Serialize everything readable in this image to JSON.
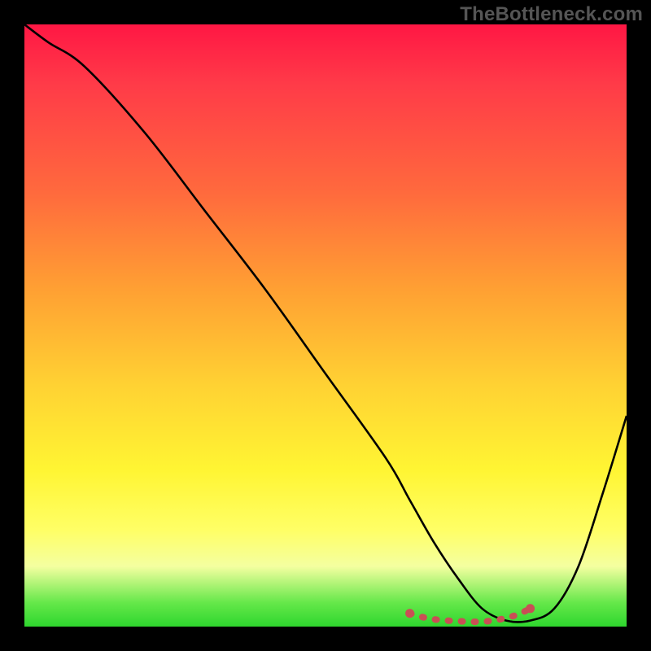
{
  "watermark": "TheBottleneck.com",
  "gradient_colors": {
    "top": "#ff1744",
    "mid_upper": "#ffa033",
    "mid": "#ffd233",
    "mid_lower": "#ffff66",
    "bottom": "#2ed62e"
  },
  "curve_stroke": "#000000",
  "marker_stroke": "#c94f55",
  "chart_data": {
    "type": "line",
    "title": "",
    "xlabel": "",
    "ylabel": "",
    "xlim": [
      0,
      100
    ],
    "ylim": [
      0,
      100
    ],
    "grid": false,
    "legend": false,
    "series": [
      {
        "name": "bottleneck-curve",
        "x": [
          0,
          4,
          10,
          20,
          30,
          40,
          50,
          60,
          64,
          68,
          72,
          76,
          80,
          84,
          88,
          92,
          96,
          100
        ],
        "values": [
          100,
          97,
          93,
          82,
          69,
          56,
          42,
          28,
          21,
          14,
          8,
          3,
          1,
          1,
          3,
          10,
          22,
          35
        ]
      }
    ],
    "markers": {
      "name": "optimal-range-dots",
      "color": "#c94f55",
      "x": [
        64,
        66,
        68,
        70,
        72,
        74,
        76,
        78,
        80,
        82,
        84
      ],
      "values": [
        2.2,
        1.6,
        1.2,
        1.0,
        0.9,
        0.8,
        0.8,
        1.0,
        1.4,
        2.0,
        3.0
      ]
    }
  }
}
